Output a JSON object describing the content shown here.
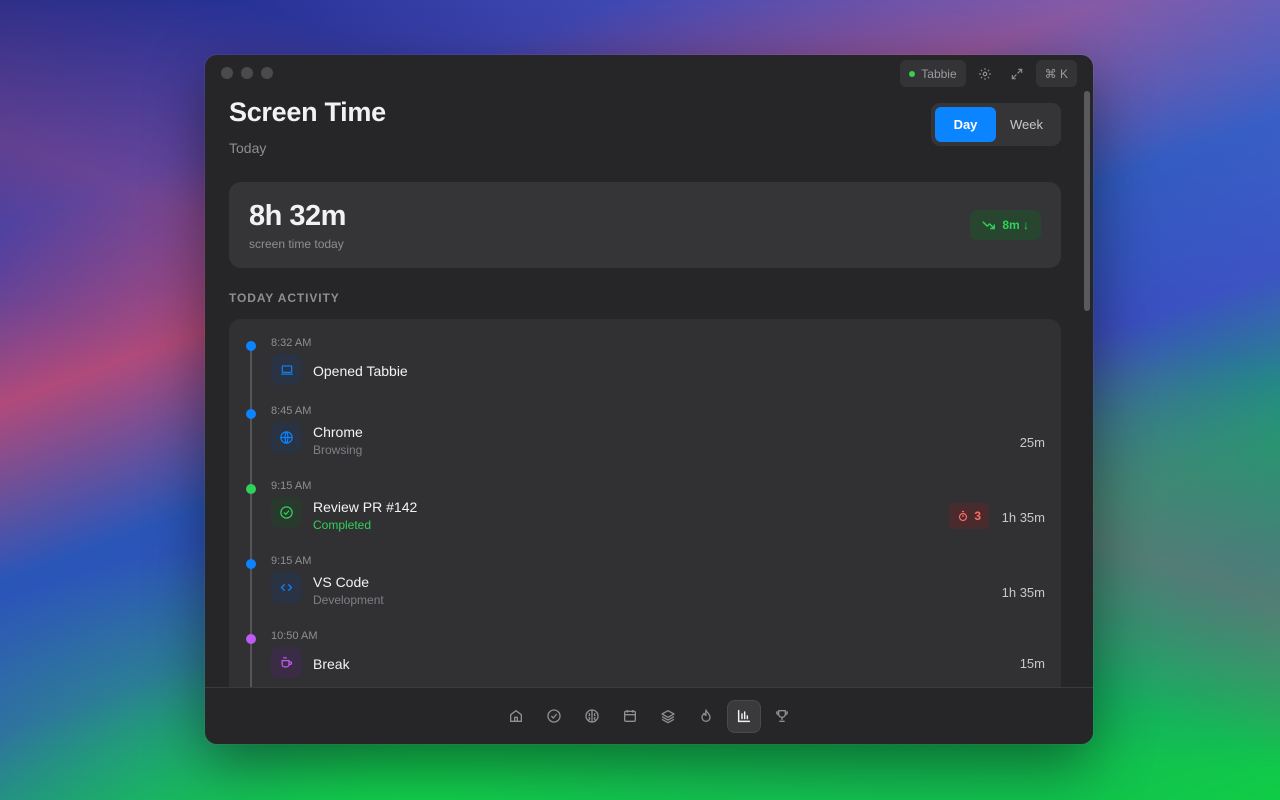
{
  "window": {
    "app_badge": "Tabbie",
    "shortcut": "⌘ K"
  },
  "header": {
    "title": "Screen Time",
    "subtitle": "Today",
    "range_options": [
      "Day",
      "Week"
    ],
    "selected_range": "Day"
  },
  "summary": {
    "value": "8h 32m",
    "caption": "screen time today",
    "trend": "8m ↓"
  },
  "activity": {
    "section_label": "TODAY ACTIVITY",
    "items": [
      {
        "time": "8:32 AM",
        "name": "Opened Tabbie",
        "subtitle": "",
        "duration": "",
        "icon": "laptop-icon",
        "color": "#0a84ff"
      },
      {
        "time": "8:45 AM",
        "name": "Chrome",
        "subtitle": "Browsing",
        "duration": "25m",
        "icon": "globe-icon",
        "color": "#0a84ff"
      },
      {
        "time": "9:15 AM",
        "name": "Review PR #142",
        "subtitle": "Completed",
        "duration": "1h 35m",
        "badge": "3",
        "icon": "check-circle-icon",
        "color": "#30d158"
      },
      {
        "time": "9:15 AM",
        "name": "VS Code",
        "subtitle": "Development",
        "duration": "1h 35m",
        "icon": "code-icon",
        "color": "#0a84ff"
      },
      {
        "time": "10:50 AM",
        "name": "Break",
        "subtitle": "",
        "duration": "15m",
        "icon": "coffee-icon",
        "color": "#bf5af2"
      }
    ]
  },
  "bottom_nav": {
    "items": [
      "home-icon",
      "check-circle-icon",
      "brain-icon",
      "calendar-icon",
      "layers-icon",
      "flame-icon",
      "bar-chart-icon",
      "trophy-icon"
    ],
    "active": "bar-chart-icon"
  },
  "colors": {
    "accent": "#0a84ff",
    "success": "#30d158",
    "danger": "#ff6b63",
    "purple": "#bf5af2"
  }
}
